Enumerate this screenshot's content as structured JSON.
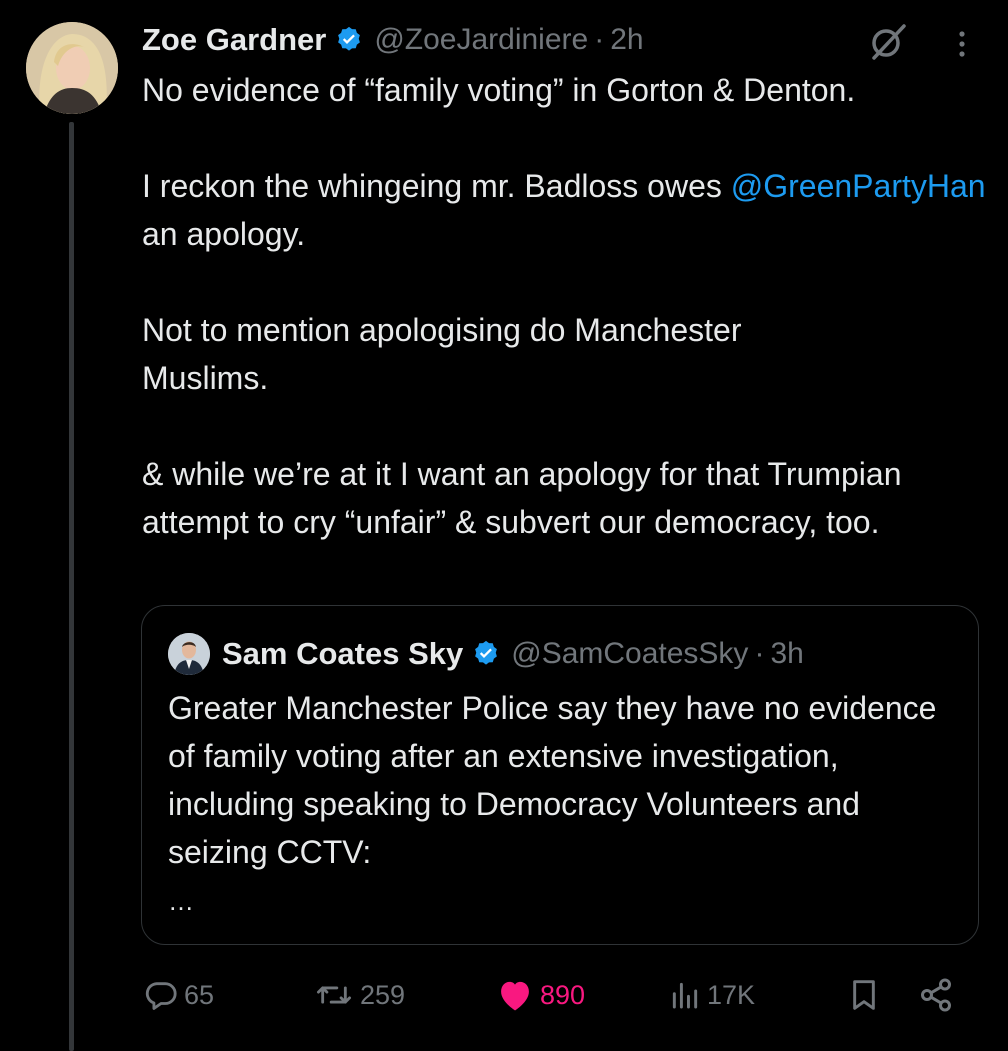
{
  "tweet": {
    "author_name": "Zoe Gardner",
    "author_handle": "@ZoeJardiniere",
    "separator": "·",
    "time": "2h",
    "paragraphs": {
      "p1": "No evidence of “family voting” in Gorton & Denton.",
      "p2_before": "I reckon the whingeing mr. Badloss owes ",
      "p2_mention": "@GreenPartyHan",
      "p2_after": " an apology.",
      "p3": "Not to mention apologising do Manchester Muslims.",
      "p4": "& while we’re at it I want an apology for that Trumpian attempt to cry “unfair” & subvert our democracy, too."
    }
  },
  "quoted_tweet": {
    "author_name": "Sam Coates Sky",
    "author_handle": "@SamCoatesSky",
    "separator": "·",
    "time": "3h",
    "text": "Greater Manchester Police say they have no evidence of family voting after an extensive investigation, including speaking to Democracy Volunteers and seizing CCTV:",
    "ellipsis": "…"
  },
  "actions": {
    "replies": "65",
    "reposts": "259",
    "likes": "890",
    "views": "17K"
  },
  "icons": {
    "verified": "verified-badge-icon",
    "grok": "grok-icon",
    "more": "more-vertical-icon",
    "reply": "reply-icon",
    "repost": "repost-icon",
    "like": "heart-filled-icon",
    "views": "views-bar-icon",
    "bookmark": "bookmark-icon",
    "share": "share-icon"
  },
  "colors": {
    "background": "#000000",
    "text": "#e7e9ea",
    "secondary": "#71767b",
    "link": "#1d9bf0",
    "like": "#f91880",
    "verified": "#1d9bf0"
  }
}
